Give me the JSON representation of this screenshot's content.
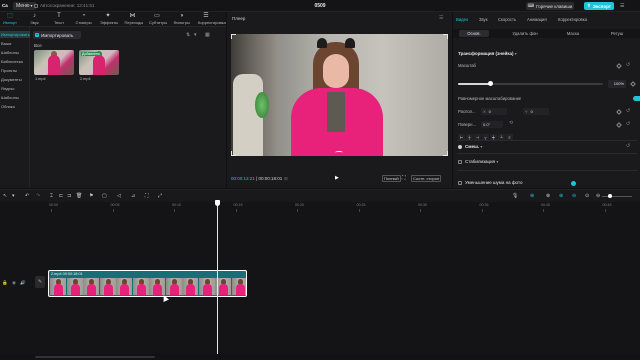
{
  "topbar": {
    "app_logo": "Ca",
    "menu_label": "Меню",
    "autosave": "Автосохранение: 12:41:51",
    "project_title": "0509",
    "shortcuts_label": "Горячие клавиши",
    "export_label": "Экспорт"
  },
  "media": {
    "tools": [
      {
        "label": "Импорт",
        "icon": "import-icon",
        "glyph": "⬚",
        "active": true
      },
      {
        "label": "Звук",
        "icon": "audio-icon",
        "glyph": "♪"
      },
      {
        "label": "Текст",
        "icon": "text-icon",
        "glyph": "T"
      },
      {
        "label": "Стикеры",
        "icon": "sticker-icon",
        "glyph": "◔"
      },
      {
        "label": "Эффекты",
        "icon": "effects-icon",
        "glyph": "✦"
      },
      {
        "label": "Переходы",
        "icon": "transition-icon",
        "glyph": "⋈"
      },
      {
        "label": "Субтитры",
        "icon": "captions-icon",
        "glyph": "▭"
      },
      {
        "label": "Фильтры",
        "icon": "filter-icon",
        "glyph": "◑"
      },
      {
        "label": "Корректировка",
        "icon": "adjust-icon",
        "glyph": "☰"
      }
    ],
    "side": [
      {
        "label": "Импортировать",
        "active": true
      },
      {
        "label": "Ваши"
      },
      {
        "label": "Шаблоны"
      },
      {
        "label": "Библиотека"
      },
      {
        "label": "Проекты"
      },
      {
        "label": "Документы"
      },
      {
        "label": "Яндекс"
      },
      {
        "label": "Шаблоны"
      },
      {
        "label": "Облако"
      }
    ],
    "import_label": "Импортировать",
    "all_label": "Все",
    "files": [
      {
        "name": "1.mp4",
        "duration": "",
        "added_badge": ""
      },
      {
        "name": "2.mp4",
        "duration": "",
        "added_badge": "Добавлено"
      }
    ]
  },
  "player": {
    "title": "Плеер",
    "current_time": "00:00:13:21",
    "separator": "|",
    "total_time": "00:00:18:01",
    "fullscreen_label": "Полный",
    "ratio_label": "Соотн. сторон"
  },
  "props": {
    "tabs": [
      "Видео",
      "Звук",
      "Скорость",
      "Анимация",
      "Корректировка"
    ],
    "subtabs": [
      "Основ.",
      "Удалить фон",
      "Маска",
      "Ретуш"
    ],
    "transform_title": "Трансформация (знейка)",
    "scale_label": "Масштаб",
    "scale_value": "100%",
    "scale_fraction": 0.22,
    "uniform_label": "Равномерное масштабирование",
    "position_label": "Распол...",
    "pos_x": "0",
    "pos_y": "0",
    "rotate_label": "Поверн...",
    "rotate_value": "0.0°",
    "blend_label": "Смеш.",
    "stabilize_label": "Стабилизация",
    "denoise_label": "Уменьшение шума на фото"
  },
  "timeline": {
    "ticks": [
      "00:00",
      "00:05",
      "00:10",
      "00:15",
      "00:20",
      "00:25",
      "00:30",
      "00:35",
      "00:40",
      "00:45"
    ],
    "clip_label": "2.mp4  00:00:18:01"
  },
  "colors": {
    "accent": "#20c4d8",
    "clip": "#176e74",
    "shirt": "#e8217a"
  }
}
